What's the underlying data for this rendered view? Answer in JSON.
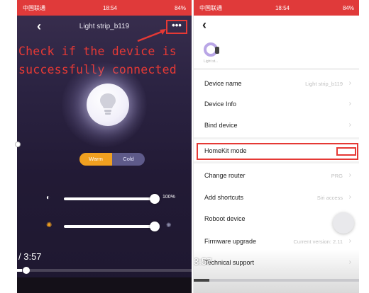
{
  "left": {
    "status_carrier": "中国联通",
    "status_time": "18:54",
    "status_right": "84%",
    "title": "Light strip_b119",
    "more_label": "•••",
    "overlay_line1": "Check if the device is",
    "overlay_line2": "successfully connected",
    "mode_warm": "Warm",
    "mode_cold": "Cold",
    "brightness_pct": "100%",
    "brightness_value": 1.0,
    "color_temp_value": 1.0,
    "video_time": "/ 3:57",
    "video_progress": 0.03
  },
  "right": {
    "status_carrier": "中国联通",
    "status_time": "18:54",
    "status_right": "84%",
    "device_small_name": "Light st...",
    "rows": [
      {
        "label": "Device name",
        "value": "Light strip_b119"
      },
      {
        "label": "Device Info",
        "value": ""
      },
      {
        "label": "Bind device",
        "value": ""
      },
      {
        "label": "HomeKit mode",
        "value": ""
      },
      {
        "label": "Change router",
        "value": "PRG"
      },
      {
        "label": "Add shortcuts",
        "value": "Siri access"
      },
      {
        "label": "Roboot device",
        "value": ""
      },
      {
        "label": "Firmware upgrade",
        "value": "Current version: 2.11"
      },
      {
        "label": "Technical support",
        "value": ""
      }
    ],
    "video_time": "3:57"
  },
  "colors": {
    "highlight": "#e53935",
    "accent_warm": "#f0a020",
    "status_bar": "#e03a3a"
  }
}
